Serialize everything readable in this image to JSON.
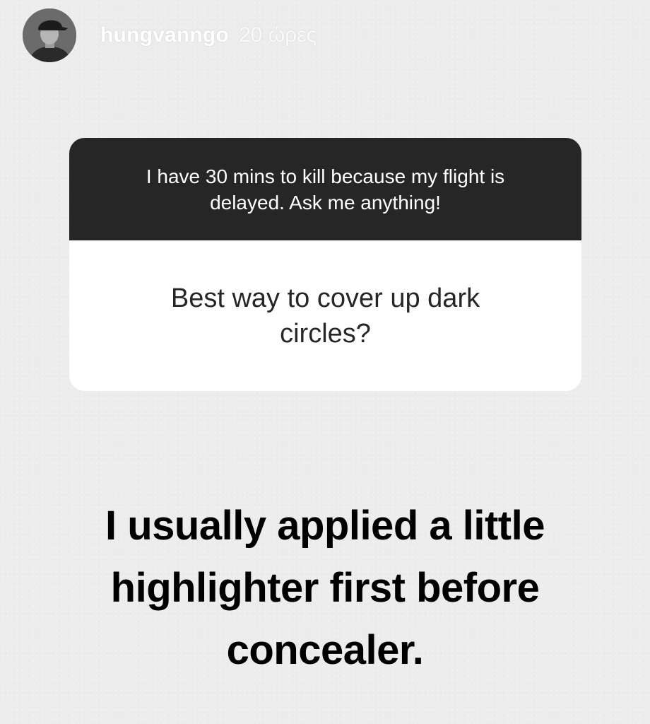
{
  "story": {
    "username": "hungvanngo",
    "timestamp": "20 ώρες",
    "avatar_icon": "profile-photo"
  },
  "question_sticker": {
    "prompt": "I have 30 mins to kill because my flight is delayed. Ask me anything!",
    "question": "Best way to cover up dark circles?"
  },
  "answer": {
    "text": "I usually applied a little highlighter first before concealer."
  },
  "colors": {
    "background": "#ececec",
    "prompt_bg": "#262626",
    "card_bg": "#ffffff",
    "answer_text": "#000000"
  }
}
